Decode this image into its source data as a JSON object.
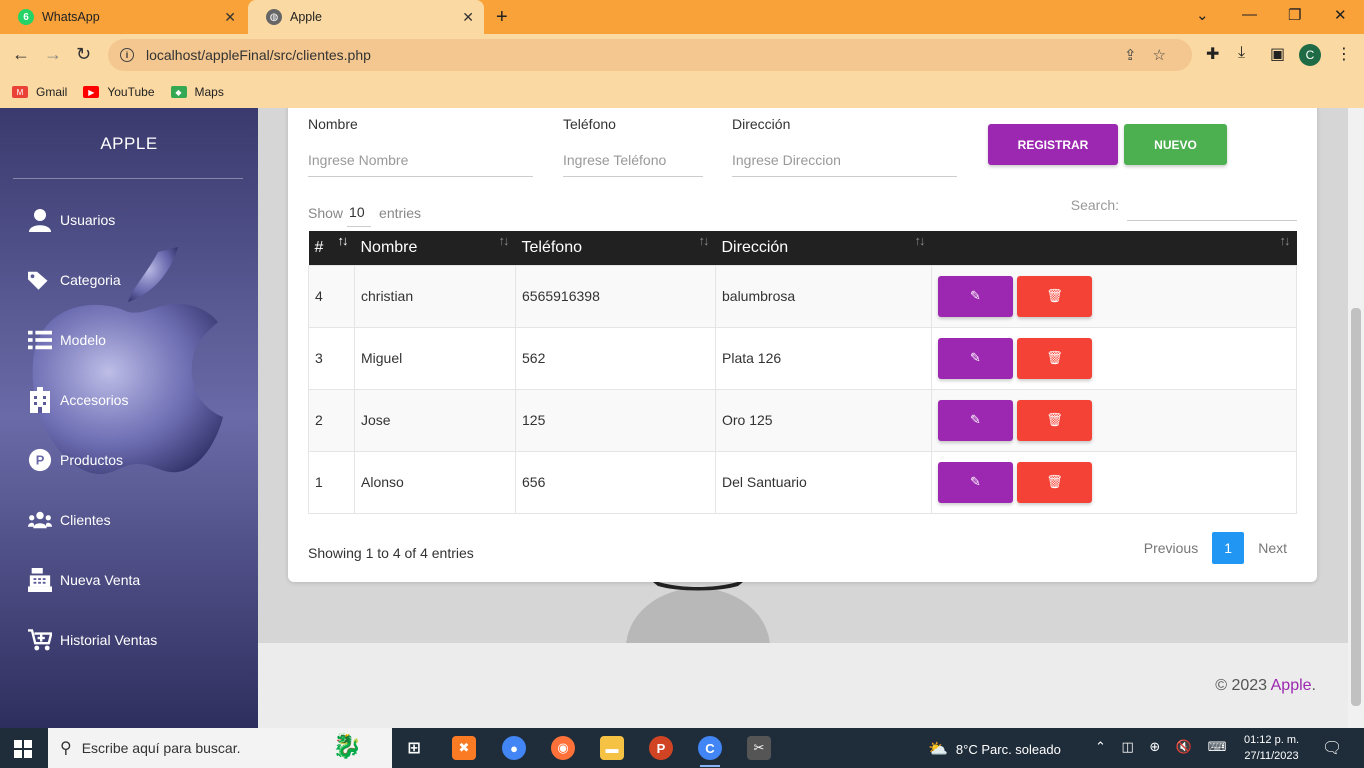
{
  "browser": {
    "tabs": [
      {
        "label": "WhatsApp",
        "badge": "6",
        "active": false
      },
      {
        "label": "Apple",
        "active": true
      }
    ],
    "url": "localhost/appleFinal/src/clientes.php",
    "bookmarks": [
      "Gmail",
      "YouTube",
      "Maps"
    ],
    "profile_initial": "C"
  },
  "sidebar": {
    "brand": "APPLE",
    "items": [
      {
        "label": "Usuarios",
        "icon": "user-icon"
      },
      {
        "label": "Categoria",
        "icon": "tags-icon"
      },
      {
        "label": "Modelo",
        "icon": "list-icon"
      },
      {
        "label": "Accesorios",
        "icon": "building-icon"
      },
      {
        "label": "Productos",
        "icon": "product-p-icon"
      },
      {
        "label": "Clientes",
        "icon": "users-icon"
      },
      {
        "label": "Nueva Venta",
        "icon": "cash-register-icon"
      },
      {
        "label": "Historial Ventas",
        "icon": "cart-plus-icon"
      }
    ]
  },
  "form": {
    "nombre_label": "Nombre",
    "nombre_placeholder": "Ingrese Nombre",
    "telefono_label": "Teléfono",
    "telefono_placeholder": "Ingrese Teléfono",
    "direccion_label": "Dirección",
    "direccion_placeholder": "Ingrese Direccion",
    "registrar_label": "REGISTRAR",
    "nuevo_label": "NUEVO"
  },
  "table_controls": {
    "show_label": "Show",
    "show_value": "10",
    "entries_label": "entries",
    "search_label": "Search:"
  },
  "table": {
    "headers": [
      "#",
      "Nombre",
      "Teléfono",
      "Dirección",
      ""
    ],
    "rows": [
      {
        "id": "4",
        "nombre": "christian",
        "telefono": "6565916398",
        "direccion": "balumbrosa"
      },
      {
        "id": "3",
        "nombre": "Miguel",
        "telefono": "562",
        "direccion": "Plata 126"
      },
      {
        "id": "2",
        "nombre": "Jose",
        "telefono": "125",
        "direccion": "Oro 125"
      },
      {
        "id": "1",
        "nombre": "Alonso",
        "telefono": "656",
        "direccion": "Del Santuario"
      }
    ]
  },
  "pagination": {
    "info": "Showing 1 to 4 of 4 entries",
    "previous": "Previous",
    "current": "1",
    "next": "Next"
  },
  "footer": {
    "copyright": "© 2023",
    "brand_link": "Apple",
    "period": "."
  },
  "colors": {
    "purple": "#9c27b0",
    "green": "#4caf50",
    "red": "#f44336",
    "blue": "#2196f3",
    "header_dark": "#212121"
  },
  "taskbar": {
    "search_placeholder": "Escribe aquí para buscar.",
    "weather": "8°C  Parc. soleado",
    "time": "01:12 p. m.",
    "date": "27/11/2023"
  }
}
